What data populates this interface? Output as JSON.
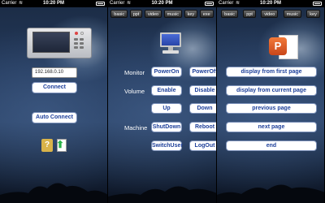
{
  "status": {
    "carrier": "Carrier",
    "time": "10:20 PM"
  },
  "tabs": [
    "basic",
    "ppt",
    "video",
    "music",
    "key",
    "exe"
  ],
  "connect_screen": {
    "ip_value": "192.168.0.10",
    "connect_label": "Connect",
    "auto_connect_label": "Auto Connect",
    "help_icon_glyph": "?",
    "exit_icon_glyph": "⬆"
  },
  "basic_screen": {
    "monitor_label": "Monitor",
    "power_on": "PowerOn",
    "power_off": "PowerOff",
    "volume_label": "Volume",
    "enable": "Enable",
    "disable": "Disable",
    "up": "Up",
    "down": "Down",
    "machine_label": "Machine",
    "shutdown": "ShutDown",
    "reboot": "Reboot",
    "switchuser": "SwitchUser",
    "logout": "LogOut"
  },
  "ppt_screen": {
    "ppt_badge_letter": "P",
    "display_first": "display from first page",
    "display_current": "display from current page",
    "previous": "previous page",
    "next": "next page",
    "end": "end"
  },
  "colors": {
    "button_text": "#1d3f9a",
    "sky": "#243a5c"
  }
}
